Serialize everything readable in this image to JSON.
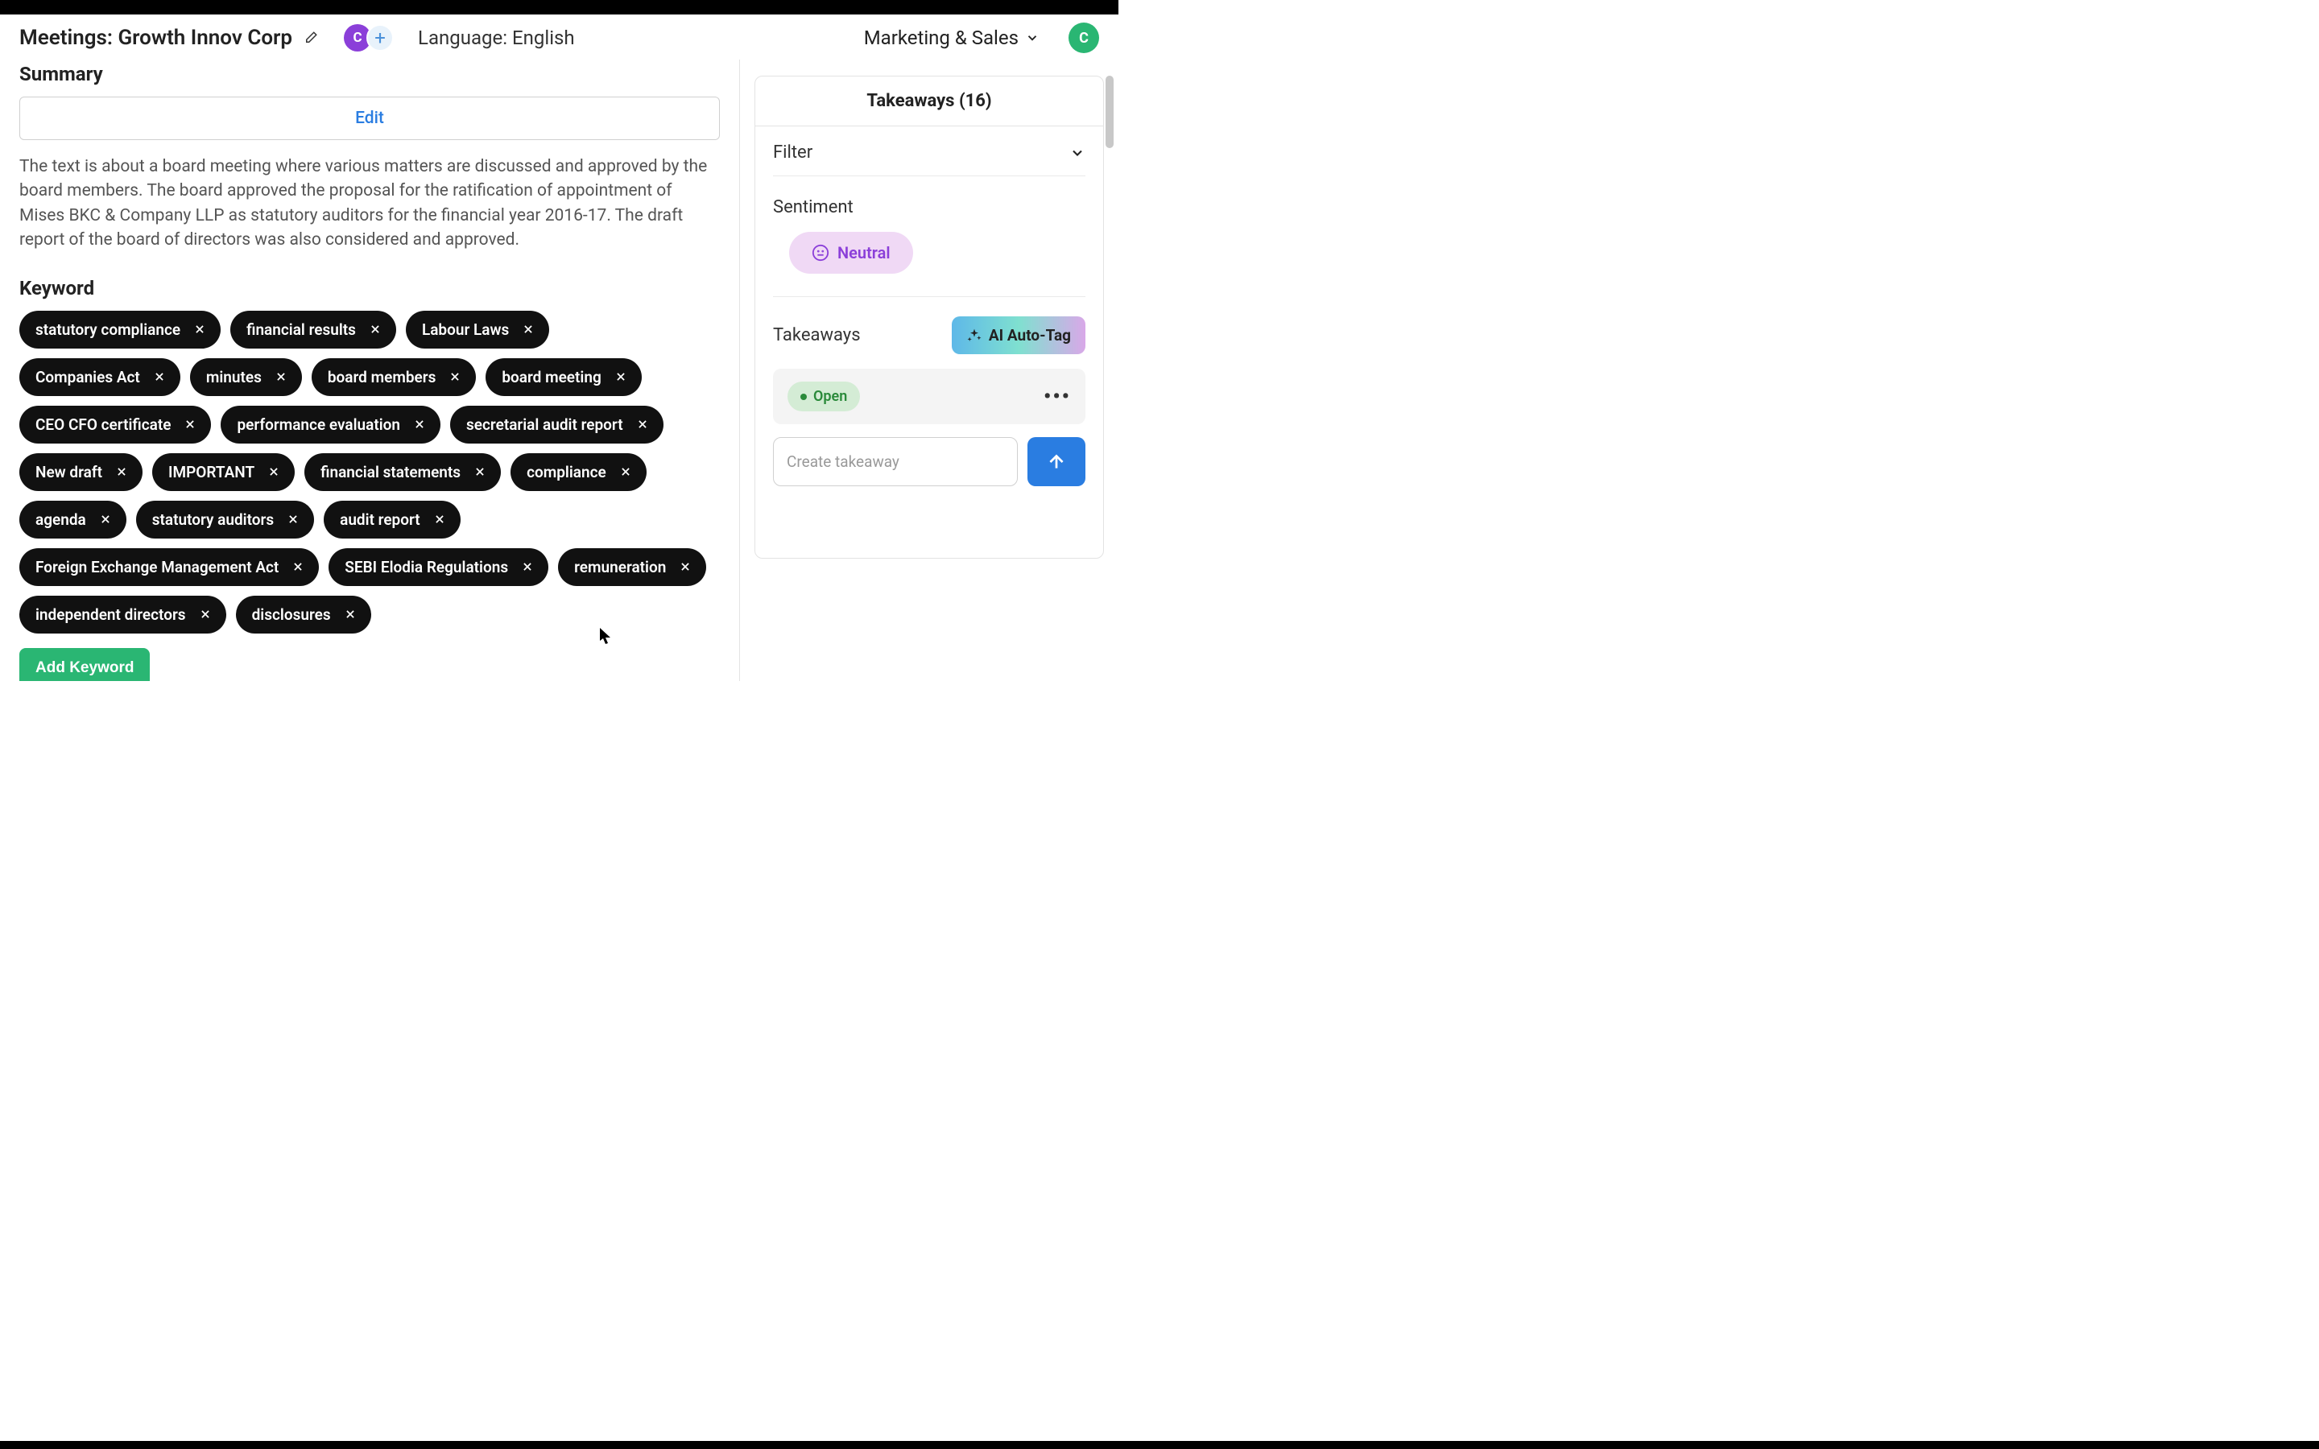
{
  "header": {
    "title": "Meetings: Growth Innov Corp",
    "avatar_letter": "C",
    "language": "Language: English",
    "category": "Marketing & Sales",
    "user_avatar_letter": "C"
  },
  "summary": {
    "section_label": "Summary",
    "edit_label": "Edit",
    "text": "The text is about a board meeting where various matters are discussed and approved by the board members. The board approved the proposal for the ratification of appointment of Mises BKC & Company LLP as statutory auditors for the financial year 2016-17. The draft report of the board of directors was also considered and approved."
  },
  "keyword": {
    "section_label": "Keyword",
    "items": [
      "statutory compliance",
      "financial results",
      "Labour Laws",
      "Companies Act",
      "minutes",
      "board members",
      "board meeting",
      "CEO CFO certificate",
      "performance evaluation",
      "secretarial audit report",
      "New draft",
      "IMPORTANT",
      "financial statements",
      "compliance",
      "agenda",
      "statutory auditors",
      "audit report",
      "Foreign Exchange Management Act",
      "SEBI Elodia Regulations",
      "remuneration",
      "independent directors",
      "disclosures"
    ],
    "add_label": "Add Keyword"
  },
  "takeaways": {
    "panel_title": "Takeaways (16)",
    "filter_label": "Filter",
    "sentiment_label": "Sentiment",
    "sentiment_value": "Neutral",
    "list_label": "Takeaways",
    "ai_button_label": "AI Auto-Tag",
    "status": "Open",
    "create_placeholder": "Create takeaway"
  }
}
